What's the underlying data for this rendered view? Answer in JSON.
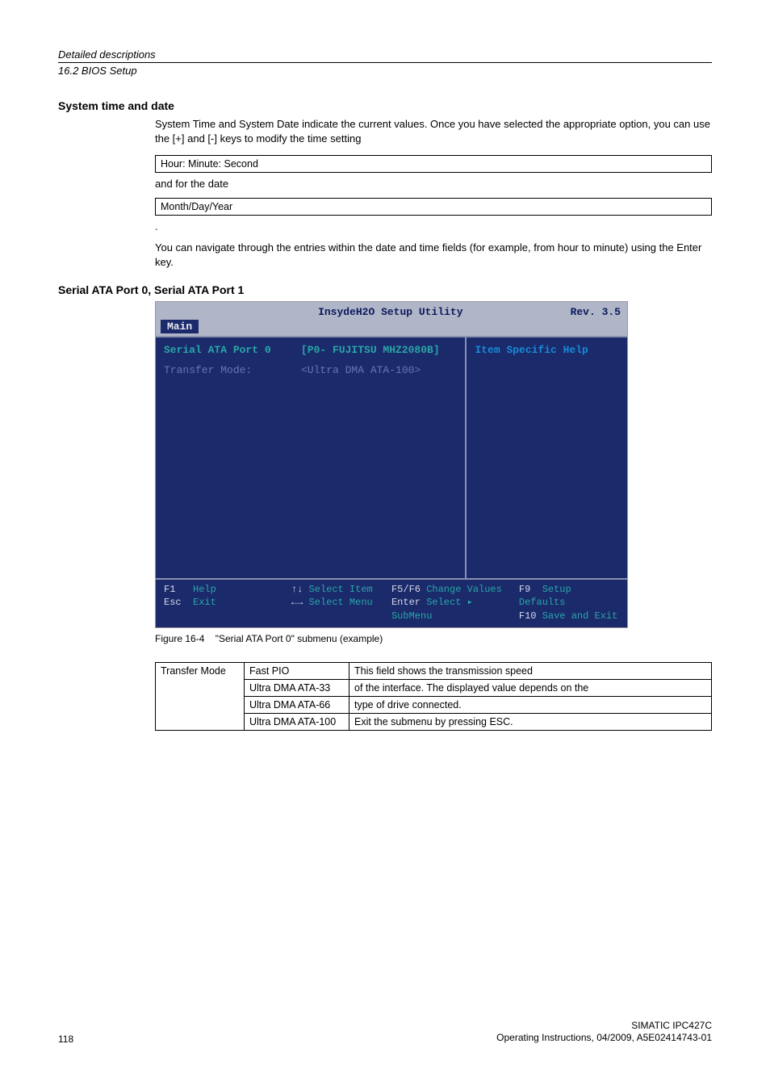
{
  "header": {
    "title": "Detailed descriptions",
    "sub": "16.2 BIOS Setup"
  },
  "s1": {
    "title": "System time and date",
    "p1": "System Time and System Date indicate the current values. Once you have selected the appropriate option, you can use the [+] and [-] keys to modify the time setting",
    "box1": "Hour: Minute: Second",
    "after1": "and for the date",
    "box2": "Month/Day/Year",
    "dot": ".",
    "p2": "You can navigate through the entries within the date and time fields (for example, from hour to minute) using the Enter key."
  },
  "s2": {
    "title": "Serial ATA Port 0, Serial ATA Port 1"
  },
  "bios": {
    "title_center": "InsydeH2O Setup Utility",
    "title_right": "Rev. 3.5",
    "tab": "Main",
    "r1_label": "Serial ATA Port 0",
    "r1_val": "[P0- FUJITSU MHZ2080B]",
    "r2_label": "Transfer Mode:",
    "r2_val": "<Ultra DMA ATA-100>",
    "help_title": "Item Specific Help",
    "f": {
      "f1": "F1",
      "help": "Help",
      "esc": "Esc",
      "exit": "Exit",
      "updown": "↑↓",
      "sel_item": "Select Item",
      "lr": "←→",
      "sel_menu": "Select Menu",
      "f5f6": "F5/F6",
      "chg": "Change Values",
      "enter": "Enter",
      "sub": "Select ▸ SubMenu",
      "f9": "F9",
      "setdef": "Setup Defaults",
      "f10": "F10",
      "save": "Save and Exit"
    }
  },
  "caption": {
    "fig": "Figure 16-4",
    "txt": "\"Serial ATA Port 0\" submenu (example)"
  },
  "table": {
    "c1": "Transfer Mode",
    "r1": "Fast PIO",
    "r2": "Ultra DMA ATA-33",
    "r3": "Ultra DMA ATA-66",
    "r4": "Ultra DMA ATA-100",
    "d1": "This field shows the transmission speed",
    "d2": "of the interface. The displayed value depends on the",
    "d3": "type of drive connected.",
    "d4": "Exit the submenu by pressing ESC."
  },
  "footer": {
    "page": "118",
    "r1": "SIMATIC IPC427C",
    "r2": "Operating Instructions, 04/2009, A5E02414743-01"
  }
}
